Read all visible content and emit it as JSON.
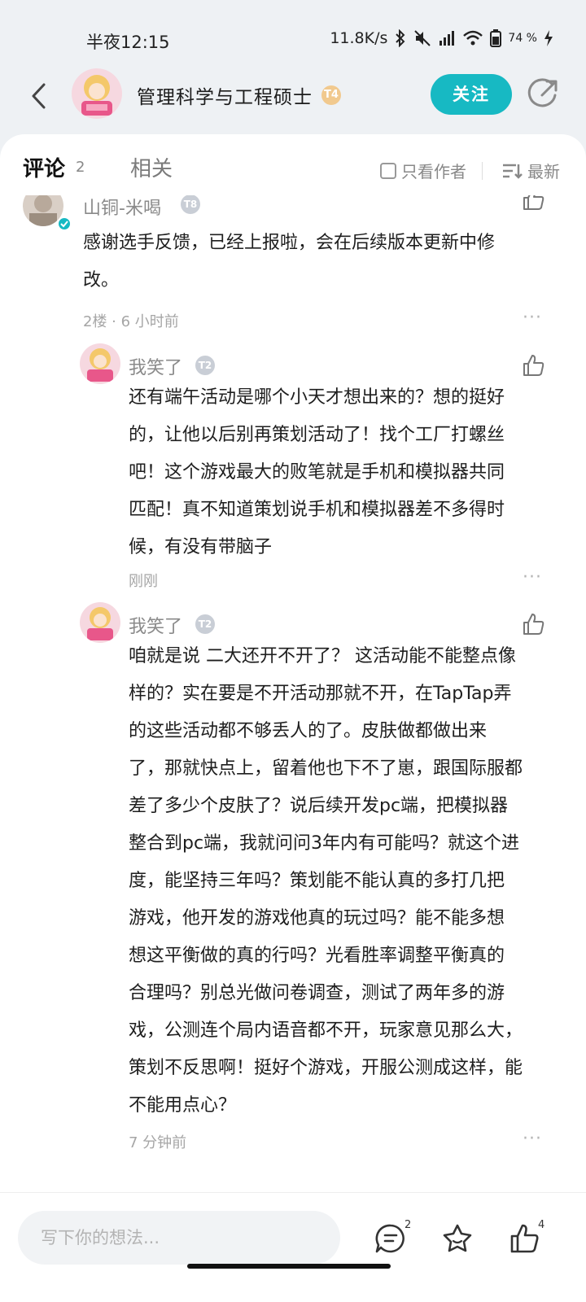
{
  "status_bar": {
    "time": "半夜12:15",
    "speed": "11.8K/s",
    "battery": "74 %"
  },
  "header": {
    "title": "管理科学与工程硕士",
    "badge": "T4",
    "follow_label": "关注"
  },
  "tabs": {
    "active": "评论",
    "active_count": "2",
    "related": "相关",
    "only_author": "只看作者",
    "sort": "最新"
  },
  "comments": [
    {
      "user": "山铜-米喝",
      "level": "T8",
      "text_lines": [
        "感谢选手反馈，已经上报啦，会在后续版本更新中修",
        "改。"
      ],
      "meta": "2楼 · 6 小时前"
    }
  ],
  "replies": [
    {
      "user": "我笑了",
      "level": "T2",
      "text_lines": [
        "还有端午活动是哪个小天才想出来的？想的挺好",
        "的，让他以后别再策划活动了！找个工厂打螺丝",
        "吧！这个游戏最大的败笔就是手机和模拟器共同",
        "匹配！真不知道策划说手机和模拟器差不多得时",
        "候，有没有带脑子"
      ],
      "meta": "刚刚"
    },
    {
      "user": "我笑了",
      "level": "T2",
      "text_lines": [
        "咱就是说 二大还开不开了？ 这活动能不能整点像",
        "样的？实在要是不开活动那就不开，在TapTap弄",
        "的这些活动都不够丢人的了。皮肤做都做出来",
        "了，那就快点上，留着他也下不了崽，跟国际服都",
        "差了多少个皮肤了？说后续开发pc端，把模拟器",
        "整合到pc端，我就问问3年内有可能吗？就这个进",
        "度，能坚持三年吗？策划能不能认真的多打几把",
        "游戏，他开发的游戏他真的玩过吗？能不能多想",
        "想这平衡做的真的行吗？光看胜率调整平衡真的",
        "合理吗？别总光做问卷调查，测试了两年多的游",
        "戏，公测连个局内语音都不开，玩家意见那么大，",
        "策划不反思啊！挺好个游戏，开服公测成这样，能",
        "不能用点心？"
      ],
      "meta": "7 分钟前"
    }
  ],
  "more_glyph": "···",
  "bottom_bar": {
    "placeholder": "写下你的想法...",
    "comment_count": "2",
    "like_count": "4"
  }
}
